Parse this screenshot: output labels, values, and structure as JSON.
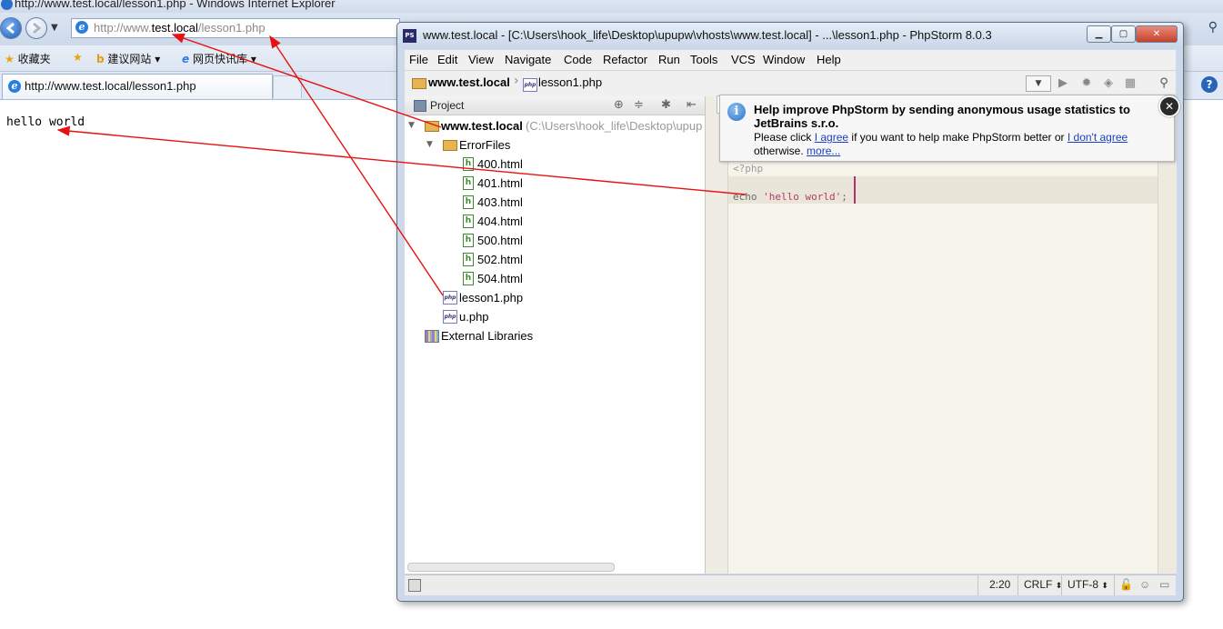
{
  "ie": {
    "window_title": "http://www.test.local/lesson1.php - Windows Internet Explorer",
    "address_domain_prefix": "http://www.",
    "address_domain_host": "test.local",
    "address_path": "/lesson1.php",
    "favorites": {
      "favorites_label": "收藏夹",
      "suggested_sites_label": "建议网站",
      "web_slice_label": "网页快讯库"
    },
    "tab_title": "http://www.test.local/lesson1.php",
    "page_text": "hello world"
  },
  "phpstorm": {
    "window_title": "www.test.local - [C:\\Users\\hook_life\\Desktop\\upupw\\vhosts\\www.test.local] - ...\\lesson1.php - PhpStorm 8.0.3",
    "menu": [
      "File",
      "Edit",
      "View",
      "Navigate",
      "Code",
      "Refactor",
      "Run",
      "Tools",
      "VCS",
      "Window",
      "Help"
    ],
    "breadcrumb": {
      "root": "www.test.local",
      "file": "lesson1.php"
    },
    "project_panel": {
      "title": "Project",
      "root_name": "www.test.local",
      "root_path": "(C:\\Users\\hook_life\\Desktop\\upup",
      "folder": "ErrorFiles",
      "html_files": [
        "400.html",
        "401.html",
        "403.html",
        "404.html",
        "500.html",
        "502.html",
        "504.html"
      ],
      "php_files": [
        "lesson1.php",
        "u.php"
      ],
      "external": "External Libraries"
    },
    "editor": {
      "line1": "<?php",
      "line2_keyword": "echo ",
      "line2_string": "'hello world'",
      "line2_end": ";"
    },
    "notification": {
      "title": "Help improve PhpStorm by sending anonymous usage statistics to JetBrains s.r.o.",
      "text_before": "Please click ",
      "agree_link": "I agree",
      "text_middle": " if you want to help make PhpStorm better or ",
      "disagree_link": "I don't agree",
      "text_after": "otherwise. ",
      "more_link": "more..."
    },
    "status": {
      "position": "2:20",
      "line_separator": "CRLF",
      "encoding": "UTF-8"
    }
  },
  "colors": {
    "annotation_arrow": "#e81010",
    "notification_link": "#1b3fc7",
    "php_string": "#b43a6a"
  }
}
